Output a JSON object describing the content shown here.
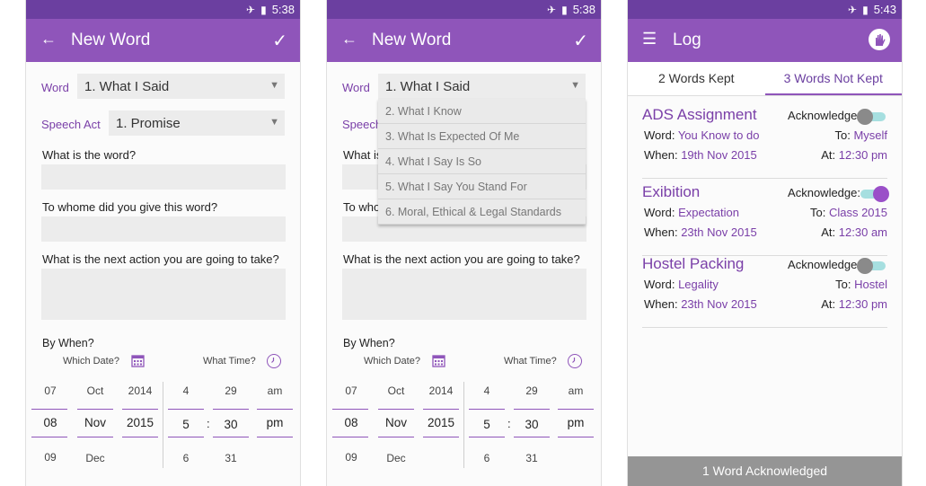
{
  "status": {
    "time1": "5:38",
    "time2": "5:38",
    "time3": "5:43"
  },
  "form": {
    "title": "New Word",
    "word_label": "Word",
    "word_value": "1. What I Said",
    "speech_label": "Speech Act",
    "speech_value": "1. Promise",
    "q1": "What is the word?",
    "q2": "To whome did you give this word?",
    "q3": "What is the next action you are going to take?",
    "by_when": "By When?",
    "which_date": "Which Date?",
    "what_time": "What Time?",
    "date_prev": {
      "day": "07",
      "month": "Oct",
      "year": "2014"
    },
    "date_sel": {
      "day": "08",
      "month": "Nov",
      "year": "2015"
    },
    "date_next": {
      "day": "09",
      "month": "Dec",
      "year": ""
    },
    "time_prev": {
      "hour": "4",
      "min": "29",
      "ampm": "am"
    },
    "time_sel": {
      "hour": "5",
      "min": "30",
      "ampm": "pm"
    },
    "time_next": {
      "hour": "6",
      "min": "31",
      "ampm": ""
    },
    "colon": ":"
  },
  "dropdown": {
    "options": [
      "2. What I Know",
      "3. What Is Expected Of Me",
      "4. What I Say Is So",
      "5. What I Say You Stand For",
      "6. Moral, Ethical & Legal Standards"
    ],
    "speech_partial": "Speech",
    "q1_partial": "What is",
    "q2_partial": "To who"
  },
  "log": {
    "title": "Log",
    "tab_kept": "2 Words Kept",
    "tab_not_kept": "3 Words Not Kept",
    "ack_label": "Acknowledge:",
    "word_label": "Word:",
    "to_label": "To:",
    "when_label": "When:",
    "at_label": "At:",
    "items": [
      {
        "title": "ADS Assignment",
        "word": "You Know to do",
        "to": "Myself",
        "when": "19th Nov 2015",
        "at": "12:30 pm",
        "acknowledged": false
      },
      {
        "title": "Exibition",
        "word": "Expectation",
        "to": "Class 2015",
        "when": "23th Nov 2015",
        "at": "12:30 am",
        "acknowledged": true
      },
      {
        "title": "Hostel Packing",
        "word": "Legality",
        "to": "Hostel",
        "when": "23th Nov 2015",
        "at": "12:30 pm",
        "acknowledged": false
      }
    ],
    "footer": "1 Word Acknowledged"
  },
  "icons": {
    "back": "arrow-back-icon",
    "check": "check-icon",
    "menu": "menu-icon",
    "logo": "hand-logo-icon",
    "calendar": "calendar-icon",
    "clock": "clock-icon",
    "dropdown_arrow": "dropdown-arrow-icon"
  },
  "colors": {
    "status_bar": "#6b3fa0",
    "app_bar": "#8f55ba",
    "accent": "#7a3fa8",
    "toggle_track": "#a6dfe0",
    "footer": "#959595"
  }
}
